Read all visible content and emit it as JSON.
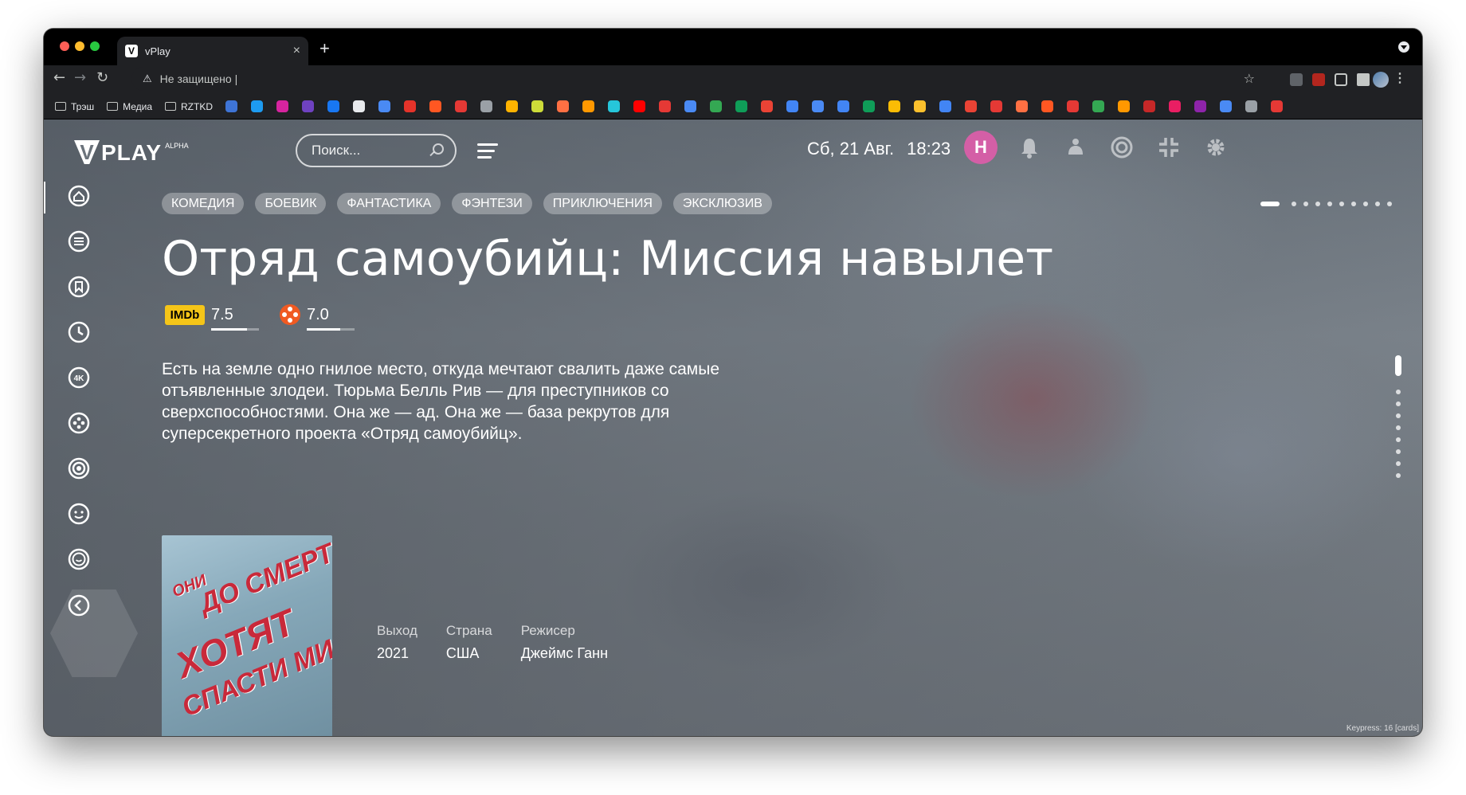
{
  "browser": {
    "tab_title": "vPlay",
    "tab_favicon": "V",
    "new_tab": "+",
    "tab_close": "×",
    "security_text": "Не защищено",
    "url": "|",
    "bookmark_folders": [
      "Трэш",
      "Медиа",
      "RZTKD"
    ],
    "bookmark_colors": [
      "#3e74d6",
      "#1d9bf0",
      "#d6249f",
      "#6f42c1",
      "#1877f2",
      "#e8eaed",
      "#4a8af4",
      "#e5332a",
      "#ff5722",
      "#e53935",
      "#9aa0a6",
      "#ffb300",
      "#cddc39",
      "#ff7043",
      "#ff9800",
      "#26c6da",
      "#ff0000",
      "#e53935",
      "#4a8af4",
      "#34a853",
      "#0f9d58",
      "#ea4335",
      "#4285f4",
      "#4a8af4",
      "#4285f4",
      "#0f9d58",
      "#fbbc05",
      "#fbc02d",
      "#4285f4",
      "#ea4335",
      "#e53935",
      "#ff7043",
      "#ff5722",
      "#e53935",
      "#34a853",
      "#ff9800",
      "#c62828",
      "#e91e63",
      "#8e24aa",
      "#4a8af4",
      "#9aa0a6",
      "#e53935"
    ]
  },
  "header": {
    "logo_text": "PLAY",
    "logo_badge": "ALPHA",
    "logo_v": "V",
    "search_placeholder": "Поиск...",
    "date": "Сб, 21 Авг.",
    "time": "18:23",
    "avatar_letter": "Н",
    "avatar_color": "#d45fa6"
  },
  "sidebar": {
    "items": [
      "home-icon",
      "list-icon",
      "bookmark-icon",
      "history-icon",
      "4k-icon",
      "film-reel-icon",
      "target-icon",
      "smile-icon",
      "smile-outline-icon"
    ],
    "collapse": "chevron-left-icon"
  },
  "genres": [
    "КОМЕДИЯ",
    "БОЕВИК",
    "ФАНТАСТИКА",
    "ФЭНТЕЗИ",
    "ПРИКЛЮЧЕНИЯ",
    "ЭКСКЛЮЗИВ"
  ],
  "slider": {
    "count": 10,
    "active": 0
  },
  "movie": {
    "title": "Отряд самоубийц: Миссия навылет",
    "imdb_label": "IMDb",
    "imdb_rating": "7.5",
    "imdb_fraction": 0.75,
    "kp_rating": "7.0",
    "kp_fraction": 0.7,
    "description": "Есть на земле одно гнилое место, откуда мечтают свалить даже самые отъявленные злодеи. Тюрьма Белль Рив — для преступников со сверхспособностями. Она же — ад. Она же — база рекрутов для суперсекретного проекта «Отряд самоубийц».",
    "poster_lines": [
      "ОНИ",
      "ДО СМЕРТИ",
      "ХОТЯТ",
      "СПАСТИ МИР"
    ],
    "meta": [
      {
        "label": "Выход",
        "value": "2021"
      },
      {
        "label": "Страна",
        "value": "США"
      },
      {
        "label": "Режисер",
        "value": "Джеймс Ганн"
      }
    ]
  },
  "vertical_pager": {
    "count": 8
  },
  "footer": {
    "keypress": "Keypress: 16 [cards]"
  }
}
